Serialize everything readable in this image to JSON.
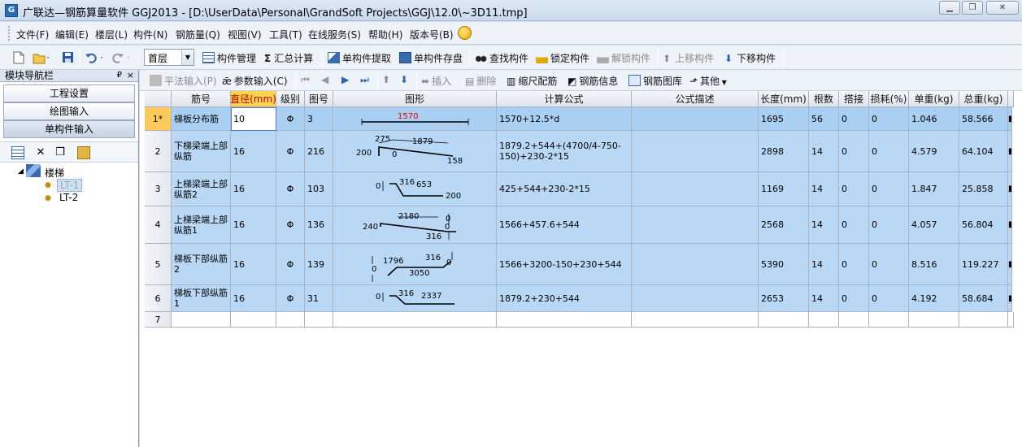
{
  "window": {
    "title": "广联达—钢筋算量软件 GGJ2013 - [D:\\UserData\\Personal\\GrandSoft Projects\\GGJ\\12.0\\~3D11.tmp]",
    "icon": "app-logo-icon"
  },
  "menu": [
    "文件(F)",
    "编辑(E)",
    "楼层(L)",
    "构件(N)",
    "钢筋量(Q)",
    "视图(V)",
    "工具(T)",
    "在线服务(S)",
    "帮助(H)",
    "版本号(B)"
  ],
  "toolbar1": {
    "floor": "首层",
    "component_mgmt": "构件管理",
    "summary_calc": "汇总计算",
    "single_extract": "单构件提取",
    "single_save": "单构件存盘",
    "find": "查找构件",
    "lock": "锁定构件",
    "unlock": "解锁构件",
    "move_up": "上移构件",
    "move_down": "下移构件"
  },
  "nav": {
    "header": "模块导航栏",
    "pin": "₽",
    "close": "×",
    "buttons": [
      "工程设置",
      "绘图输入",
      "单构件输入"
    ],
    "tree_root": "楼梯",
    "tree_items": [
      "LT-1",
      "LT-2"
    ]
  },
  "toolbar2": {
    "flat_input": "平法输入(P)",
    "param_input": "参数输入(C)",
    "insert": "插入",
    "delete": "删除",
    "scale_rebar": "缩尺配筋",
    "rebar_info": "钢筋信息",
    "rebar_lib": "钢筋图库",
    "other": "其他"
  },
  "table": {
    "columns": [
      "筋号",
      "直径(mm)",
      "级别",
      "图号",
      "图形",
      "计算公式",
      "公式描述",
      "长度(mm)",
      "根数",
      "搭接",
      "损耗(%)",
      "单重(kg)",
      "总重(kg)"
    ],
    "rows": [
      {
        "no": "1*",
        "name": "梯板分布筋",
        "dia": "10",
        "grade": "Φ",
        "fig": "3",
        "formula": "1570+12.5*d",
        "desc": "",
        "len": "1695",
        "count": "56",
        "lap": "0",
        "loss": "0",
        "unit": "1.046",
        "total": "58.566"
      },
      {
        "no": "2",
        "name": "下梯梁端上部纵筋",
        "dia": "16",
        "grade": "Φ",
        "fig": "216",
        "formula": "1879.2+544+(4700/4-750-150)+230-2*15",
        "desc": "",
        "len": "2898",
        "count": "14",
        "lap": "0",
        "loss": "0",
        "unit": "4.579",
        "total": "64.104"
      },
      {
        "no": "3",
        "name": "上梯梁端上部纵筋2",
        "dia": "16",
        "grade": "Φ",
        "fig": "103",
        "formula": "425+544+230-2*15",
        "desc": "",
        "len": "1169",
        "count": "14",
        "lap": "0",
        "loss": "0",
        "unit": "1.847",
        "total": "25.858"
      },
      {
        "no": "4",
        "name": "上梯梁端上部纵筋1",
        "dia": "16",
        "grade": "Φ",
        "fig": "136",
        "formula": "1566+457.6+544",
        "desc": "",
        "len": "2568",
        "count": "14",
        "lap": "0",
        "loss": "0",
        "unit": "4.057",
        "total": "56.804"
      },
      {
        "no": "5",
        "name": "梯板下部纵筋2",
        "dia": "16",
        "grade": "Φ",
        "fig": "139",
        "formula": "1566+3200-150+230+544",
        "desc": "",
        "len": "5390",
        "count": "14",
        "lap": "0",
        "loss": "0",
        "unit": "8.516",
        "total": "119.227"
      },
      {
        "no": "6",
        "name": "梯板下部纵筋1",
        "dia": "16",
        "grade": "Φ",
        "fig": "31",
        "formula": "1879.2+230+544",
        "desc": "",
        "len": "2653",
        "count": "14",
        "lap": "0",
        "loss": "0",
        "unit": "4.192",
        "total": "58.684"
      },
      {
        "no": "7",
        "name": "",
        "dia": "",
        "grade": "",
        "fig": "",
        "formula": "",
        "desc": "",
        "len": "",
        "count": "",
        "lap": "",
        "loss": "",
        "unit": "",
        "total": ""
      }
    ],
    "shapes": {
      "r1": [
        "1570"
      ],
      "r2": [
        "275",
        "1879",
        "200",
        "0",
        "158"
      ],
      "r3": [
        "0",
        "316",
        "653",
        "200"
      ],
      "r4": [
        "2180",
        "0",
        "240",
        "316",
        "0"
      ],
      "r5": [
        "1796",
        "316",
        "0",
        "0",
        "3050"
      ],
      "r6": [
        "0",
        "316",
        "2337"
      ]
    }
  }
}
